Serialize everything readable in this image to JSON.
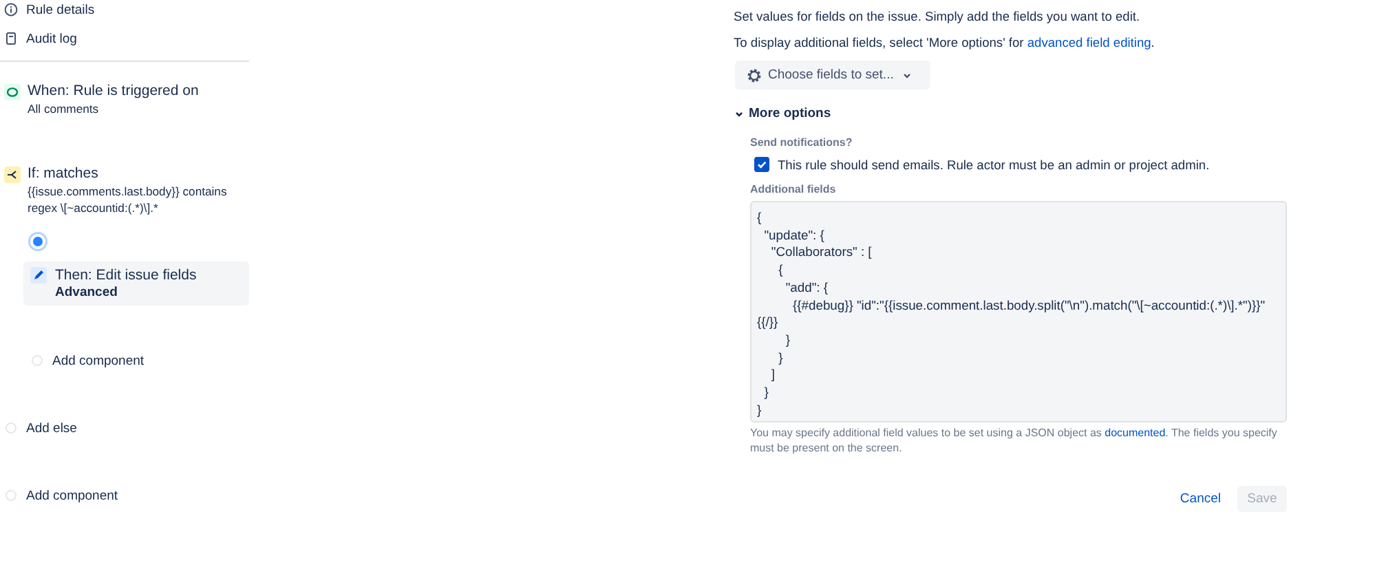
{
  "nav": [
    {
      "label": "Rule details"
    },
    {
      "label": "Audit log"
    }
  ],
  "flow": [
    {
      "kind": "trigger",
      "title": "When: Rule is triggered on",
      "detail": "All comments"
    },
    {
      "kind": "condition",
      "title": "If: matches",
      "detail": "{{issue.comments.last.body}} contains regex \\[~accountid:(.*)\\].*"
    },
    {
      "kind": "node",
      "selected": true
    },
    {
      "kind": "action",
      "title": "Then: Edit issue fields",
      "detail": "Advanced",
      "selected": true
    },
    {
      "kind": "add-nested",
      "label": "Add component"
    },
    {
      "kind": "add",
      "label": "Add else"
    },
    {
      "kind": "add",
      "label": "Add component"
    }
  ],
  "editor": {
    "intro": "Set values for fields on the issue. Simply add the fields you want to edit.",
    "hint": "To display additional fields, select 'More options' for ",
    "hint_link": "advanced field editing",
    "hint_end": ".",
    "choose_button": "Choose fields to set...",
    "more_options": {
      "label": "More options",
      "expanded": true
    },
    "notify_label": "Send notifications?",
    "notify": {
      "label": "This rule should send emails. Rule actor must be an admin or project admin.",
      "checked": true
    },
    "additional_label": "Additional fields",
    "additional_value": "{\n  \"update\": {\n    \"Collaborators\" : [\n      {\n        \"add\": {\n          {{#debug}} \"id\":\"{{issue.comment.last.body.split(\"\\n\").match(\"\\[~accountid:(.*)\\].*\")}}\" {{/}}\n        }\n      }\n    ]\n  }\n}",
    "help": "You may specify additional field values to be set using a JSON object as ",
    "help_link": "documented",
    "help_end": ". The fields you specify must be present on the screen.",
    "cancel": "Cancel",
    "save": {
      "label": "Save",
      "disabled": true
    }
  }
}
